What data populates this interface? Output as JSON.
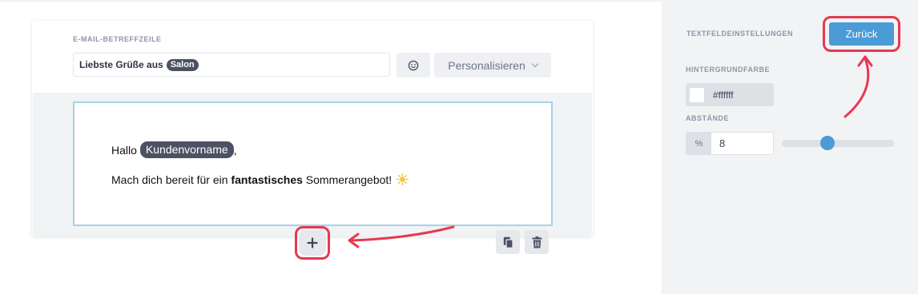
{
  "subject": {
    "label": "E-MAIL-BETREFFZEILE",
    "text": "Liebste Grüße aus",
    "tag": "Salon",
    "emoji_icon": "emoji-icon",
    "personalize_label": "Personalisieren"
  },
  "content_block": {
    "greeting": "Hallo",
    "name_tag": "Kundenvorname",
    "greeting_suffix": ",",
    "line_before": "Mach dich bereit für ein",
    "line_bold": "fantastisches",
    "line_after": "Sommerangebot!",
    "sun_icon": "sun-emoji-icon"
  },
  "block_actions": {
    "add_icon": "plus-icon",
    "copy_icon": "copy-icon",
    "delete_icon": "trash-icon"
  },
  "sidebar": {
    "title": "TEXTFELDEINSTELLUNGEN",
    "back_label": "Zurück",
    "bg_label": "HINTERGRUNDFARBE",
    "bg_value": "#ffffff",
    "spacing_label": "ABSTÄNDE",
    "spacing_unit": "%",
    "spacing_value": "8",
    "spacing_slider_fraction": 0.41
  },
  "colors": {
    "accent": "#4a9bd6",
    "annotation": "#e63950",
    "tag": "#4b5264",
    "block_border": "#a6d3ea"
  }
}
